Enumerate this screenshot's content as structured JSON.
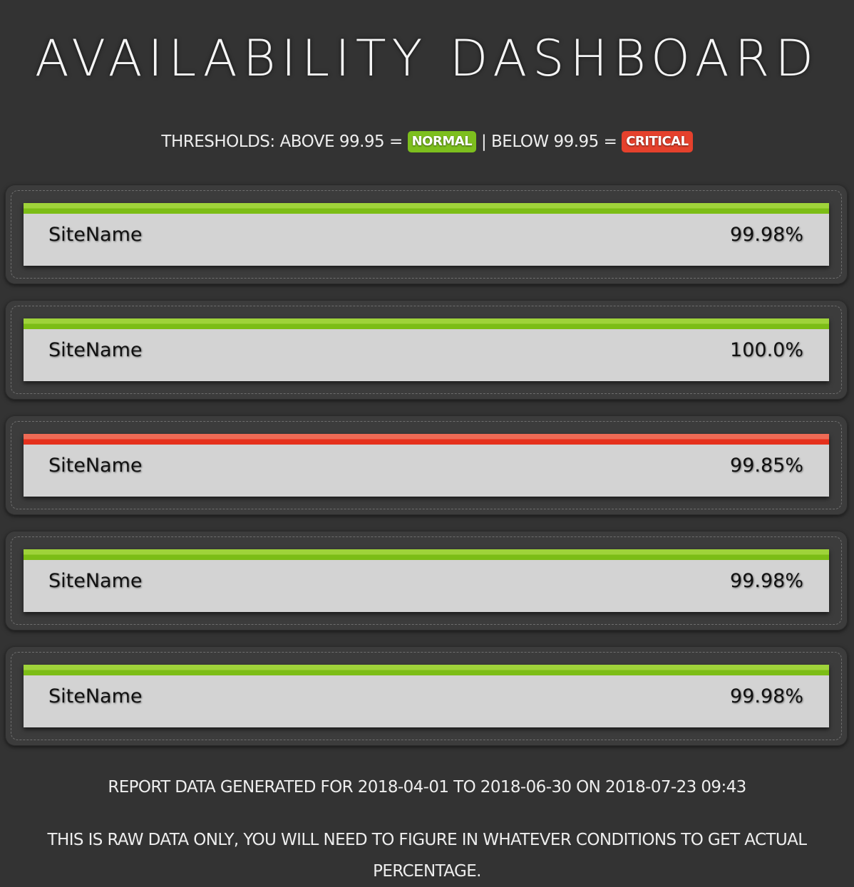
{
  "header": {
    "title": "AVAILABILITY DASHBOARD"
  },
  "thresholds": {
    "prefix": "THRESHOLDS: ABOVE 99.95 =",
    "normal_label": "NORMAL",
    "separator": "| BELOW 99.95 =",
    "critical_label": "CRITICAL"
  },
  "colors": {
    "background": "#333333",
    "normal": "#7cbd16",
    "critical": "#e5301c",
    "tile": "#d3d3d3"
  },
  "sites": [
    {
      "name": "SiteName",
      "value": "99.98%",
      "status": "normal"
    },
    {
      "name": "SiteName",
      "value": "100.0%",
      "status": "normal"
    },
    {
      "name": "SiteName",
      "value": "99.85%",
      "status": "critical"
    },
    {
      "name": "SiteName",
      "value": "99.98%",
      "status": "normal"
    },
    {
      "name": "SiteName",
      "value": "99.98%",
      "status": "normal"
    }
  ],
  "footer": {
    "report": "REPORT DATA GENERATED FOR 2018-04-01 TO 2018-06-30 ON 2018-07-23 09:43",
    "note": "THIS IS RAW DATA ONLY, YOU WILL NEED TO FIGURE IN WHATEVER CONDITIONS TO GET ACTUAL PERCENTAGE."
  }
}
